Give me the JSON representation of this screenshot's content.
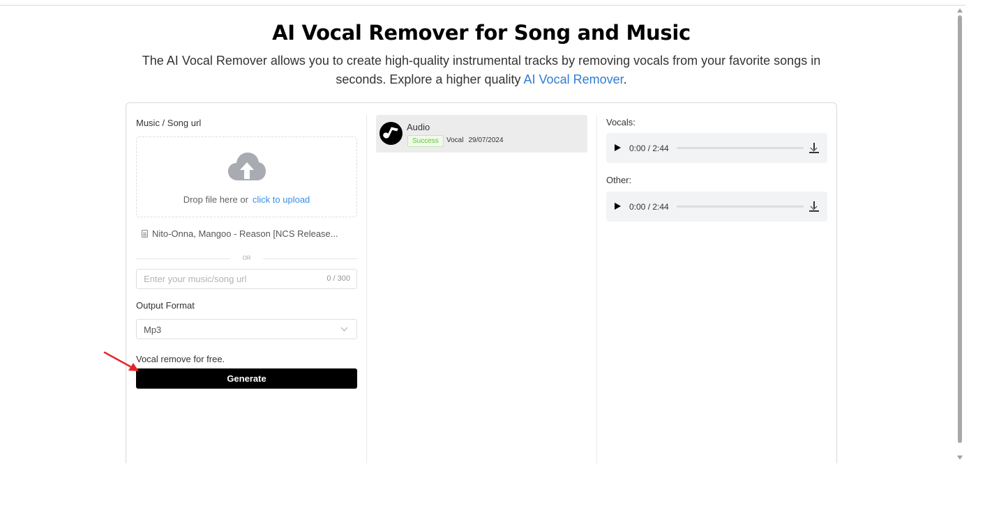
{
  "header": {
    "title": "AI Vocal Remover for Song and Music",
    "subtitle_before_link": "The AI Vocal Remover allows you to create high-quality instrumental tracks by removing vocals from your favorite songs in seconds. Explore a higher quality ",
    "subtitle_link": "AI Vocal Remover",
    "subtitle_after_link": "."
  },
  "form": {
    "url_label": "Music / Song url",
    "drop_text": "Drop file here or",
    "upload_link": "click to upload",
    "uploaded_file": "Nito-Onna, Mangoo - Reason [NCS Release...",
    "or_text": "OR",
    "url_placeholder": "Enter your music/song url",
    "url_value": "",
    "url_count": "0 / 300",
    "format_label": "Output Format",
    "format_value": "Mp3",
    "free_text": "Vocal remove for free.",
    "generate_label": "Generate"
  },
  "history": {
    "item_title": "Audio",
    "status": "Success",
    "type": "Vocal",
    "date": "29/07/2024"
  },
  "results": {
    "vocals_label": "Vocals:",
    "vocals_time": "0:00 / 2:44",
    "other_label": "Other:",
    "other_time": "0:00 / 2:44"
  },
  "colors": {
    "accent_link": "#2f7dd1",
    "success": "#67c23a",
    "button": "#000000",
    "annotation_arrow": "#e3262a"
  },
  "icons": {
    "upload": "cloud-upload-icon",
    "file": "document-icon",
    "chevron": "chevron-down-icon",
    "music": "music-note-icon",
    "play": "play-icon",
    "download": "download-icon",
    "annotation": "red-arrow-icon"
  }
}
